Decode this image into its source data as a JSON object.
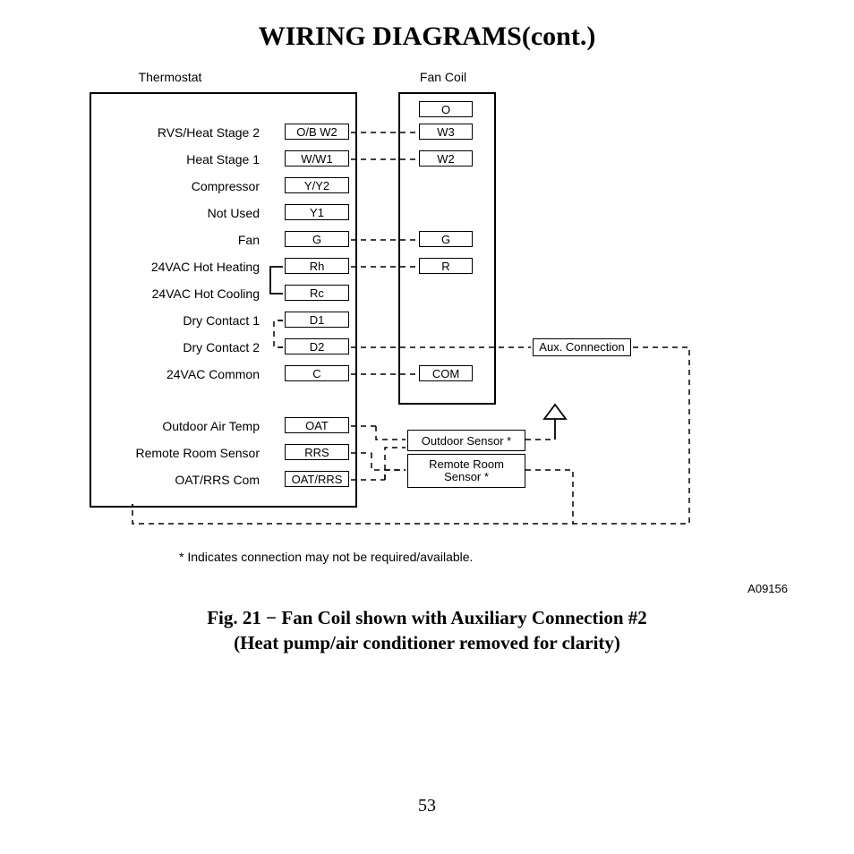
{
  "title": "WIRING DIAGRAMS(cont.)",
  "columns": {
    "thermostat": "Thermostat",
    "fancoil": "Fan Coil"
  },
  "thermostat_rows": [
    {
      "label": "RVS/Heat Stage 2",
      "terminal": "O/B W2"
    },
    {
      "label": "Heat Stage 1",
      "terminal": "W/W1"
    },
    {
      "label": "Compressor",
      "terminal": "Y/Y2"
    },
    {
      "label": "Not Used",
      "terminal": "Y1"
    },
    {
      "label": "Fan",
      "terminal": "G"
    },
    {
      "label": "24VAC Hot Heating",
      "terminal": "Rh"
    },
    {
      "label": "24VAC Hot Cooling",
      "terminal": "Rc"
    },
    {
      "label": "Dry Contact 1",
      "terminal": "D1"
    },
    {
      "label": "Dry Contact 2",
      "terminal": "D2"
    },
    {
      "label": "24VAC Common",
      "terminal": "C"
    }
  ],
  "thermostat_rows2": [
    {
      "label": "Outdoor Air Temp",
      "terminal": "OAT"
    },
    {
      "label": "Remote Room Sensor",
      "terminal": "RRS"
    },
    {
      "label": "OAT/RRS Com",
      "terminal": "OAT/RRS"
    }
  ],
  "fancoil_terms": {
    "O": "O",
    "W3": "W3",
    "W2": "W2",
    "G": "G",
    "R": "R",
    "COM": "COM"
  },
  "aux_label": "Aux. Connection",
  "outdoor_sensor": "Outdoor Sensor *",
  "remote_sensor": "Remote Room\nSensor *",
  "footnote": "*   Indicates connection may not be required/available.",
  "figure_id": "A09156",
  "caption_line1": "Fig. 21 − Fan Coil shown with Auxiliary Connection #2",
  "caption_line2": "(Heat pump/air conditioner removed for clarity)",
  "page_number": "53"
}
